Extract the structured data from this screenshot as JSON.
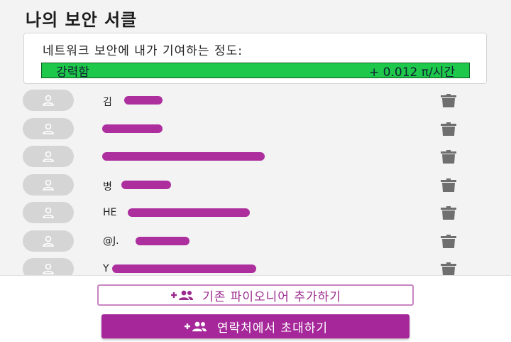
{
  "header": {
    "title": "나의 보안 서클"
  },
  "contribution": {
    "label": "네트워크 보안에 내가 기여하는 정도:",
    "level": "강력함",
    "rate": "+ 0.012 π/시간",
    "bar_color": "#1dc84a"
  },
  "members": [
    {
      "visible_text": "김",
      "avatar_icon": "user-icon",
      "action_icon": "trash-icon"
    },
    {
      "visible_text": "",
      "avatar_icon": "user-icon",
      "action_icon": "trash-icon"
    },
    {
      "visible_text": "",
      "avatar_icon": "user-icon",
      "action_icon": "trash-icon"
    },
    {
      "visible_text": "병",
      "avatar_icon": "user-icon",
      "action_icon": "trash-icon"
    },
    {
      "visible_text": "HE",
      "avatar_icon": "user-icon",
      "action_icon": "trash-icon"
    },
    {
      "visible_text": "@J.",
      "avatar_icon": "user-icon",
      "action_icon": "trash-icon"
    },
    {
      "visible_text": "Y",
      "avatar_icon": "user-icon",
      "action_icon": "trash-icon"
    }
  ],
  "actions": {
    "add_existing_label": "기존 파이오니어 추가하기",
    "invite_contacts_label": "연락처에서 초대하기",
    "icon": "add-group-icon",
    "accent_color": "#a5279a"
  }
}
